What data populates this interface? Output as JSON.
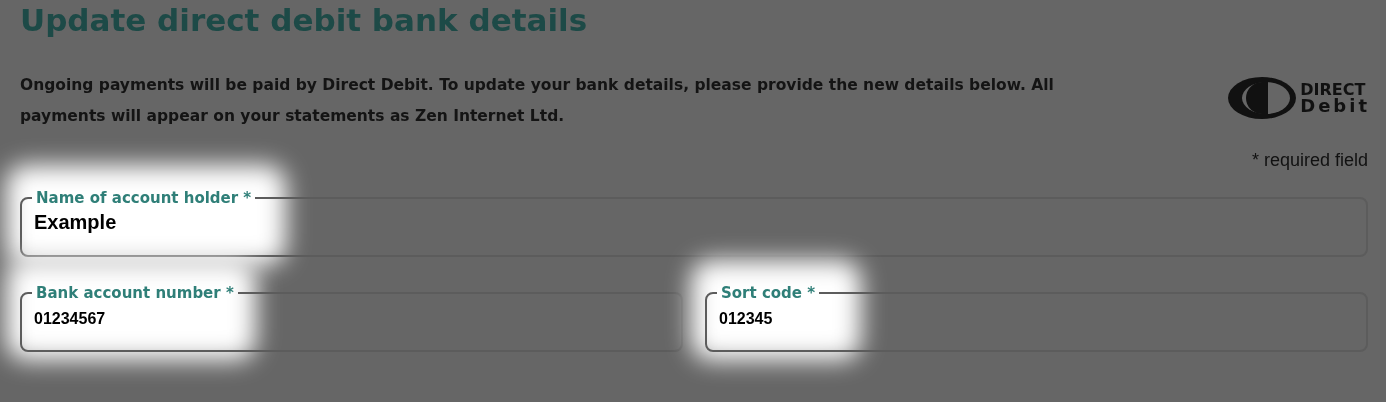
{
  "title": "Update direct debit bank details",
  "intro": "Ongoing payments will be paid by Direct Debit. To update your bank details, please provide the new details below. All payments will appear on your statements as Zen Internet Ltd.",
  "logo": {
    "line_1": "DIRECT",
    "line_2": "Debit"
  },
  "required_note": "* required field",
  "fields": [
    {
      "label": "Name of account holder *",
      "value": "Example",
      "highlighted": true,
      "kind": "wide"
    },
    {
      "label": "Bank account number *",
      "value": "01234567",
      "highlighted": true,
      "kind": "half"
    },
    {
      "label": "Sort code *",
      "value": "012345",
      "highlighted": true,
      "kind": "half"
    }
  ]
}
